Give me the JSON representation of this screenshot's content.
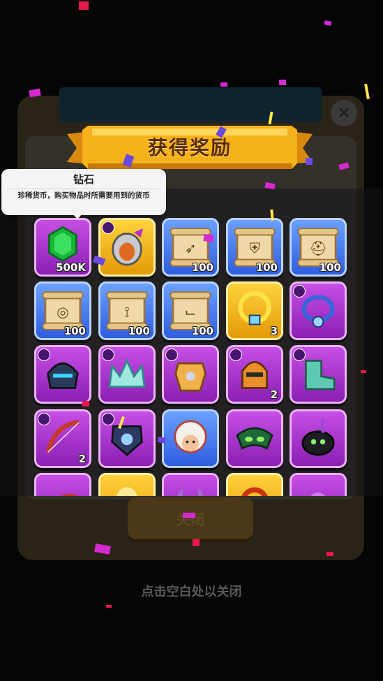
{
  "dialog": {
    "title": "获得奖励",
    "close_label": "关闭",
    "dismiss_hint": "点击空白处以关闭"
  },
  "tooltip": {
    "title": "钻石",
    "description": "珍稀货币，购买物品时所需要用到的货币"
  },
  "rewards": [
    {
      "name": "diamond",
      "icon": "green-gem-icon",
      "frame": "purple",
      "quantity": "500K"
    },
    {
      "name": "claw-weapon",
      "icon": "claw-gauntlet-icon",
      "frame": "gold",
      "quantity": ""
    },
    {
      "name": "bow-scroll",
      "icon": "scroll-bow-icon",
      "frame": "blue",
      "quantity": "100"
    },
    {
      "name": "armor-scroll",
      "icon": "scroll-armor-icon",
      "frame": "blue",
      "quantity": "100"
    },
    {
      "name": "helmet-scroll",
      "icon": "scroll-helmet-icon",
      "frame": "blue",
      "quantity": "100"
    },
    {
      "name": "ring-scroll",
      "icon": "scroll-ring-icon",
      "frame": "blue",
      "quantity": "100"
    },
    {
      "name": "necklace-scroll",
      "icon": "scroll-necklace-icon",
      "frame": "blue",
      "quantity": "100"
    },
    {
      "name": "boots-scroll",
      "icon": "scroll-boots-icon",
      "frame": "blue",
      "quantity": "100"
    },
    {
      "name": "golden-wings",
      "icon": "golden-wings-icon",
      "frame": "gold",
      "quantity": "3"
    },
    {
      "name": "necklace",
      "icon": "necklace-icon",
      "frame": "purple",
      "quantity": ""
    },
    {
      "name": "mask-helmet",
      "icon": "mask-helmet-icon",
      "frame": "purple",
      "quantity": ""
    },
    {
      "name": "ice-crown",
      "icon": "crown-icon",
      "frame": "purple",
      "quantity": ""
    },
    {
      "name": "gold-armor",
      "icon": "armor-icon",
      "frame": "purple",
      "quantity": ""
    },
    {
      "name": "knight-helmet",
      "icon": "knight-helmet-icon",
      "frame": "purple",
      "quantity": "2"
    },
    {
      "name": "mech-boots",
      "icon": "boots-icon",
      "frame": "purple",
      "quantity": ""
    },
    {
      "name": "red-bow",
      "icon": "bow-icon",
      "frame": "purple",
      "quantity": "2"
    },
    {
      "name": "dark-armor",
      "icon": "dark-armor-icon",
      "frame": "purple",
      "quantity": ""
    },
    {
      "name": "lion-hat-hero",
      "icon": "lion-costume-icon",
      "frame": "blue",
      "quantity": ""
    },
    {
      "name": "jester-mask",
      "icon": "jester-mask-icon",
      "frame": "purple",
      "quantity": ""
    },
    {
      "name": "cauldron-pet",
      "icon": "cauldron-icon",
      "frame": "purple",
      "quantity": ""
    },
    {
      "name": "row5-item-1",
      "icon": "dragon-icon",
      "frame": "purple",
      "quantity": ""
    },
    {
      "name": "row5-item-2",
      "icon": "gold-item-icon",
      "frame": "gold",
      "quantity": ""
    },
    {
      "name": "row5-item-3",
      "icon": "horns-icon",
      "frame": "purple",
      "quantity": ""
    },
    {
      "name": "row5-item-4",
      "icon": "fire-ring-icon",
      "frame": "gold",
      "quantity": ""
    },
    {
      "name": "row5-item-5",
      "icon": "purple-item-icon",
      "frame": "purple",
      "quantity": ""
    }
  ],
  "colors": {
    "purple_frame": "#b23ddb",
    "blue_frame": "#4a7df0",
    "gold_frame": "#f4b81f",
    "banner": "#f6b21a"
  }
}
